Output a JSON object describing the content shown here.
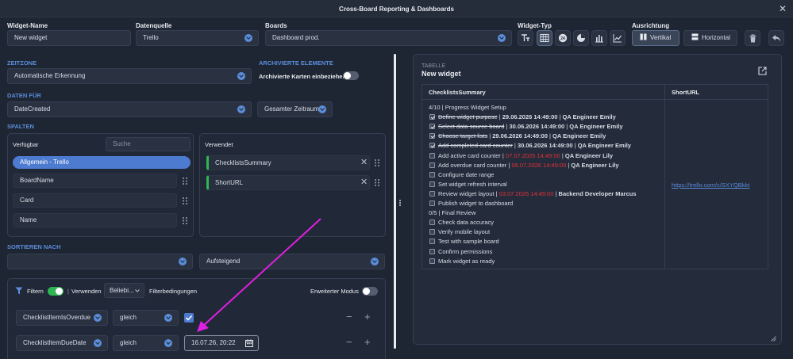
{
  "window": {
    "title": "Cross-Board Reporting & Dashboards"
  },
  "labels": {
    "widget_name": "Widget-Name",
    "datasource": "Datenquelle",
    "boards": "Boards",
    "widget_type": "Widget-Typ",
    "orientation": "Ausrichtung"
  },
  "fields": {
    "widget_name": "New widget",
    "datasource": "Trello",
    "boards": "Dashboard prod."
  },
  "orientation": {
    "vertical": "Vertikal",
    "horizontal": "Horizontal"
  },
  "sections": {
    "timezone": "ZEITZONE",
    "archived": "ARCHIVIERTE ELEMENTE",
    "data_for": "DATEN FÜR",
    "columns": "SPALTEN",
    "sort_by": "SORTIEREN NACH"
  },
  "timezone_value": "Automatische Erkennung",
  "archived_label": "Archivierte Karten einbeziehen",
  "data_for_value": "DateCreated",
  "range_value": "Gesamter Zeitraum",
  "columns": {
    "available_label": "Verfügbar",
    "search_placeholder": "Suche",
    "group": "Allgemein - Trello",
    "available": [
      "BoardName",
      "Card",
      "Name"
    ],
    "used_label": "Verwendet",
    "used": [
      "ChecklistsSummary",
      "ShortURL"
    ]
  },
  "sort": {
    "field": "",
    "direction": "Aufsteigend"
  },
  "filter": {
    "label": "Filtern",
    "use_label": "Verwenden",
    "use_value": "Beliebi...",
    "conditions_label": "Filterbedingungen",
    "advanced_label": "Erweiterter Modus",
    "rows": [
      {
        "field": "ChecklistItemIsOverdue",
        "op": "gleich",
        "value": ""
      },
      {
        "field": "ChecklistItemDueDate",
        "op": "gleich",
        "value": "16.07.26, 20:22"
      }
    ]
  },
  "preview": {
    "type_label": "TABELLE",
    "title": "New widget",
    "headers": [
      "ChecklistsSummary",
      "ShortURL"
    ],
    "url": "https://trello.com/c/SXYQBkkt",
    "lines": [
      {
        "kind": "heading",
        "text": "4/10 | Progress Widget Setup"
      },
      {
        "kind": "item",
        "checked": true,
        "name": "Define widget purpose",
        "sep1": " | ",
        "date": "29.06.2026 14:49:00",
        "sep2": " | ",
        "who": "QA Engineer Emily",
        "overdue": false
      },
      {
        "kind": "item",
        "checked": true,
        "name": "Select data source board",
        "sep1": " | ",
        "date": "30.06.2026 14:49:00",
        "sep2": " | ",
        "who": "QA Engineer Emily",
        "overdue": false
      },
      {
        "kind": "item",
        "checked": true,
        "name": "Choose target lists",
        "sep1": " | ",
        "date": "29.06.2026 14:49:00",
        "sep2": " | ",
        "who": "QA Engineer Emily",
        "overdue": false
      },
      {
        "kind": "item",
        "checked": true,
        "name": "Add completed card counter",
        "sep1": " | ",
        "date": "30.06.2026 14:49:00",
        "sep2": " | ",
        "who": "QA Engineer Emily",
        "overdue": false
      },
      {
        "kind": "item",
        "checked": false,
        "name": "Add active card counter",
        "sep1": " | ",
        "date": "07.07.2026 14:49:00",
        "sep2": " | ",
        "who": "QA Engineer Lily",
        "overdue": true
      },
      {
        "kind": "item",
        "checked": false,
        "name": "Add overdue card counter",
        "sep1": " | ",
        "date": "06.07.2026 14:49:00",
        "sep2": " | ",
        "who": "QA Engineer Lily",
        "overdue": true
      },
      {
        "kind": "item",
        "checked": false,
        "name": "Configure date range",
        "sep1": "",
        "date": "",
        "sep2": "",
        "who": "",
        "overdue": false
      },
      {
        "kind": "item",
        "checked": false,
        "name": "Set widget refresh interval",
        "sep1": "",
        "date": "",
        "sep2": "",
        "who": "",
        "overdue": false
      },
      {
        "kind": "item",
        "checked": false,
        "name": "Review widget layout",
        "sep1": " | ",
        "date": "03.07.2026 14:49:00",
        "sep2": " | ",
        "who": "Backend Developer Marcus",
        "overdue": true
      },
      {
        "kind": "item",
        "checked": false,
        "name": "Publish widget to dashboard",
        "sep1": "",
        "date": "",
        "sep2": "",
        "who": "",
        "overdue": false
      },
      {
        "kind": "heading",
        "text": "0/5 | Final Review"
      },
      {
        "kind": "item",
        "checked": false,
        "name": "Check data accuracy",
        "sep1": "",
        "date": "",
        "sep2": "",
        "who": "",
        "overdue": false
      },
      {
        "kind": "item",
        "checked": false,
        "name": "Verify mobile layout",
        "sep1": "",
        "date": "",
        "sep2": "",
        "who": "",
        "overdue": false
      },
      {
        "kind": "item",
        "checked": false,
        "name": "Test with sample board",
        "sep1": "",
        "date": "",
        "sep2": "",
        "who": "",
        "overdue": false
      },
      {
        "kind": "item",
        "checked": false,
        "name": "Confirm permissions",
        "sep1": "",
        "date": "",
        "sep2": "",
        "who": "",
        "overdue": false
      },
      {
        "kind": "item",
        "checked": false,
        "name": "Mark widget as ready",
        "sep1": "",
        "date": "",
        "sep2": "",
        "who": "",
        "overdue": false
      }
    ]
  },
  "colors": {
    "accent": "#5b8dd9",
    "toggle_on": "#2fb551",
    "overdue": "#e0333a",
    "annotation_arrow": "#e020e0"
  },
  "icons": [
    "text-type-icon",
    "table-icon",
    "number-badge-icon",
    "pie-chart-icon",
    "bar-chart-icon",
    "line-chart-icon",
    "trash-icon",
    "undo-icon",
    "external-link-icon",
    "calendar-icon",
    "filter-icon"
  ]
}
